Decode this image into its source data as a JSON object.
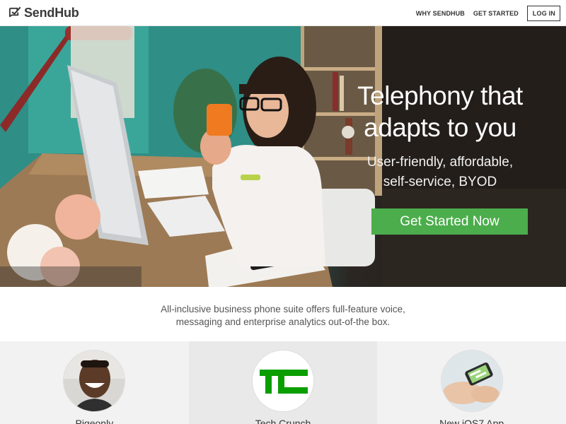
{
  "header": {
    "logo_text": "SendHub",
    "nav": [
      {
        "label": "WHY SENDHUB"
      },
      {
        "label": "GET STARTED"
      }
    ],
    "login_label": "LOG IN"
  },
  "hero": {
    "title_line1": "Telephony that",
    "title_line2": "adapts to you",
    "subtitle_line1": "User-friendly, affordable,",
    "subtitle_line2": "self-service, BYOD",
    "cta_label": "Get Started Now"
  },
  "tagline": {
    "line1": "All-inclusive business phone suite offers full-feature voice,",
    "line2": "messaging and enterprise analytics out-of-the box."
  },
  "features": [
    {
      "label": "Pigeonly"
    },
    {
      "label": "Tech Crunch"
    },
    {
      "label": "New iOS7 App"
    }
  ],
  "colors": {
    "cta": "#4cad4c",
    "teal_wall": "#35a194"
  }
}
